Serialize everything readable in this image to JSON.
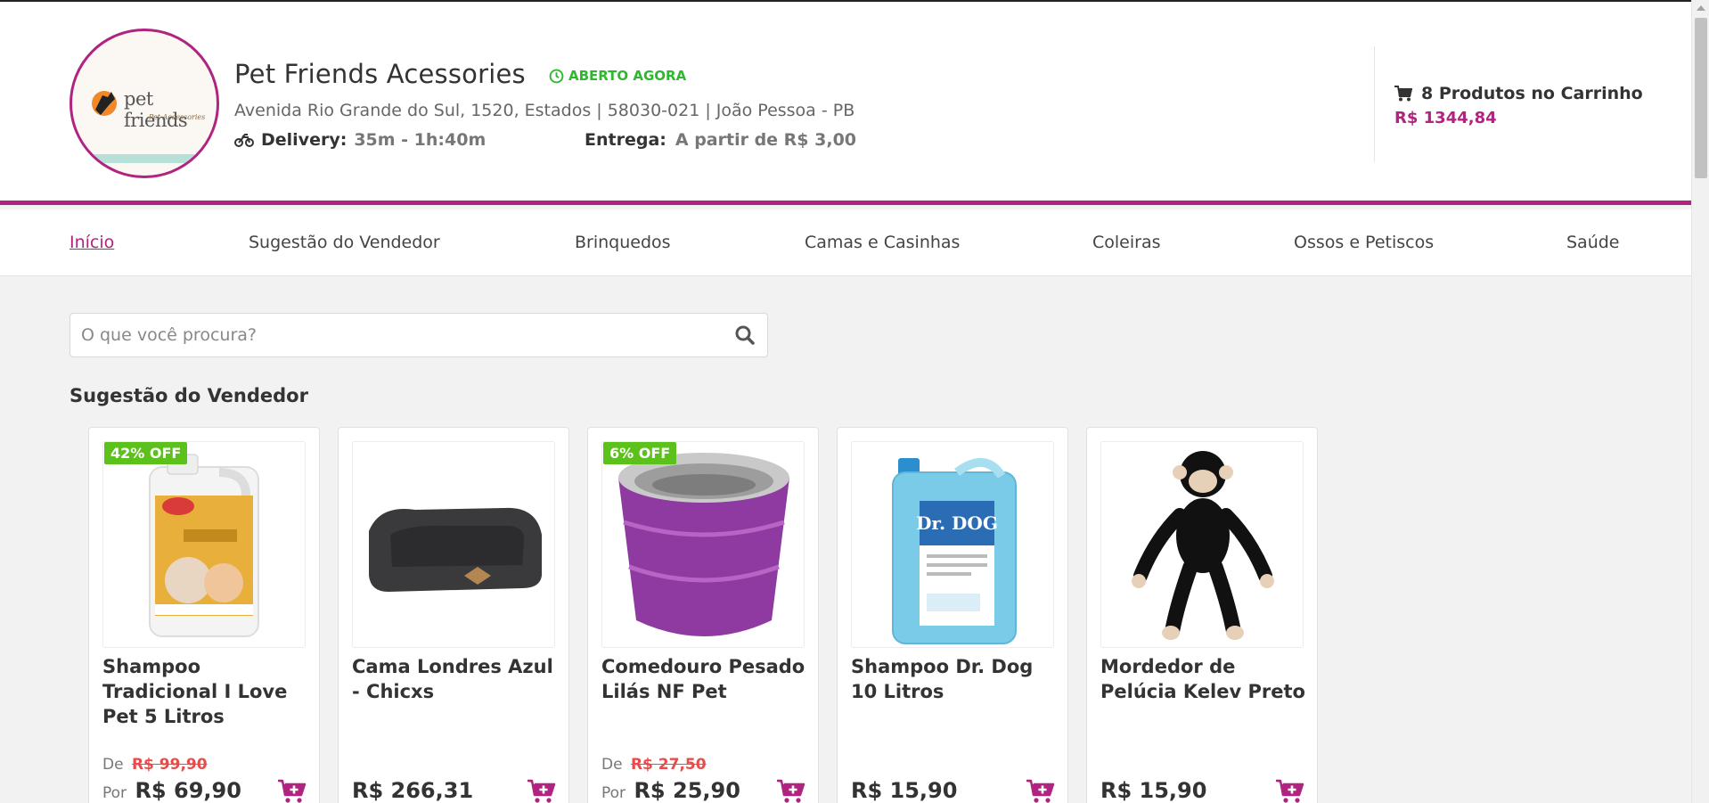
{
  "store": {
    "logo_text": "pet friends",
    "logo_sub": "Pet Accessories",
    "name": "Pet Friends Acessories",
    "status": "ABERTO AGORA",
    "address": "Avenida Rio Grande do Sul, 1520, Estados | 58030-021 | João Pessoa - PB",
    "delivery_label": "Delivery:",
    "delivery_time": "35m - 1h:40m",
    "entrega_label": "Entrega:",
    "entrega_value": "A partir de R$ 3,00"
  },
  "cart": {
    "summary": "8 Produtos no Carrinho",
    "total": "R$ 1344,84"
  },
  "nav": {
    "items": [
      {
        "label": "Início",
        "active": true
      },
      {
        "label": "Sugestão do Vendedor"
      },
      {
        "label": "Brinquedos"
      },
      {
        "label": "Camas e Casinhas"
      },
      {
        "label": "Coleiras"
      },
      {
        "label": "Ossos e Petiscos"
      },
      {
        "label": "Saúde"
      }
    ]
  },
  "search": {
    "placeholder": "O que você procura?"
  },
  "section": {
    "title": "Sugestão do Vendedor"
  },
  "products": [
    {
      "badge": "42% OFF",
      "name": "Shampoo Tradicional I Love Pet 5 Litros",
      "de_label": "De",
      "old_price": "R$ 99,90",
      "por_label": "Por",
      "price": "R$ 69,90"
    },
    {
      "name": "Cama Londres Azul - Chicxs",
      "price": "R$ 266,31"
    },
    {
      "badge": "6% OFF",
      "name": "Comedouro Pesado Lilás NF Pet",
      "de_label": "De",
      "old_price": "R$ 27,50",
      "por_label": "Por",
      "price": "R$ 25,90"
    },
    {
      "name": "Shampoo Dr. Dog 10 Litros",
      "price": "R$ 15,90",
      "image_label": "Dr. DOG"
    },
    {
      "name": "Mordedor de Pelúcia Kelev Preto",
      "price": "R$ 15,90"
    }
  ],
  "colors": {
    "brand": "#b0247f",
    "open": "#2db82d",
    "discount_badge": "#5cc21b",
    "old_price": "#e94b4b"
  },
  "icons": {
    "clock": "clock-icon",
    "moto": "motorcycle-icon",
    "cart": "cart-icon",
    "search": "search-icon",
    "add_cart": "add-to-cart-icon"
  }
}
